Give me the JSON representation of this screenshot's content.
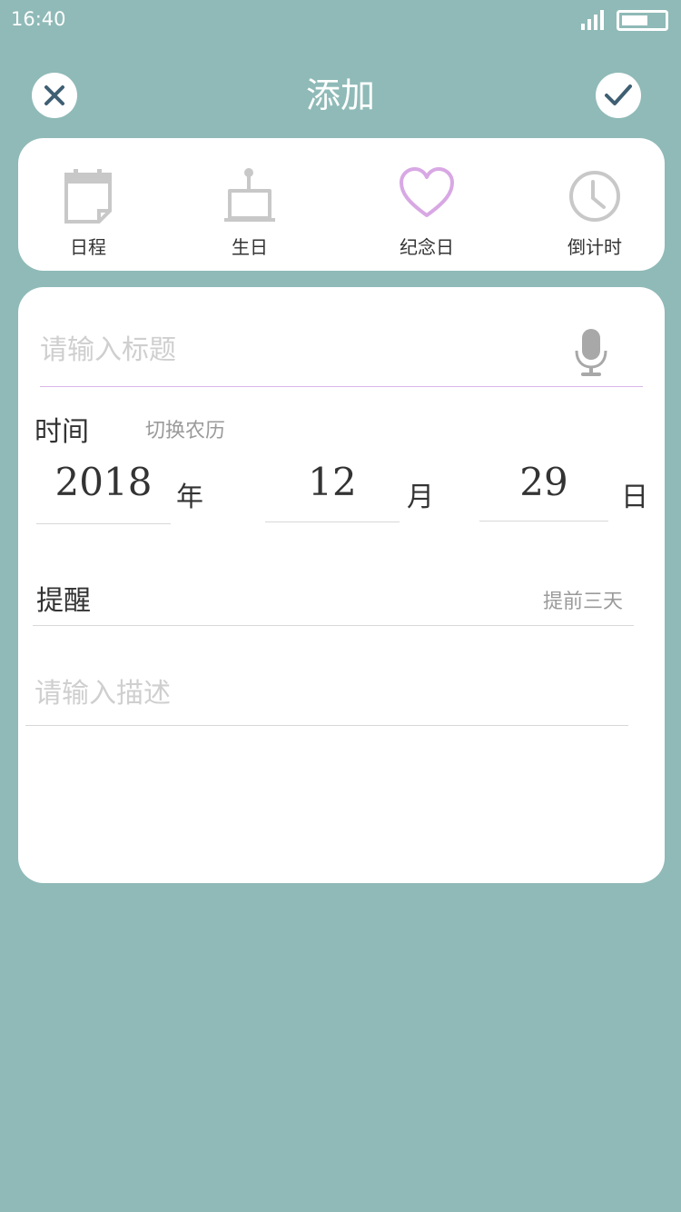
{
  "status_bar": {
    "time": "16:40",
    "signal_icon": "signal-bars-icon",
    "battery_icon": "battery-icon"
  },
  "header": {
    "title": "添加",
    "close_icon": "close-icon",
    "confirm_icon": "check-icon"
  },
  "types": [
    {
      "label": "日程",
      "icon": "calendar-icon",
      "selected": false
    },
    {
      "label": "生日",
      "icon": "cake-icon",
      "selected": false
    },
    {
      "label": "纪念日",
      "icon": "heart-icon",
      "selected": true
    },
    {
      "label": "倒计时",
      "icon": "clock-icon",
      "selected": false
    }
  ],
  "form": {
    "title_placeholder": "请输入标题",
    "mic_icon": "microphone-icon",
    "time_label": "时间",
    "lunar_toggle": "切换农历",
    "date": {
      "year": "2018",
      "year_unit": "年",
      "month": "12",
      "month_unit": "月",
      "day": "29",
      "day_unit": "日"
    },
    "remind_label": "提醒",
    "remind_value": "提前三天",
    "desc_placeholder": "请输入描述"
  },
  "colors": {
    "background": "#8fbab7",
    "card": "#ffffff",
    "accent_selected": "#d8a8e4",
    "icon_inactive": "#c8c8c8",
    "header_icon": "#3f5f73"
  }
}
